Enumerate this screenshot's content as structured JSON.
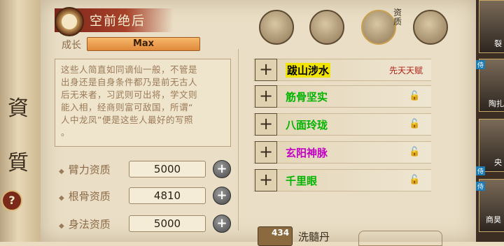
{
  "scroll": {
    "chars": [
      "資",
      "質"
    ],
    "help_glyph": "?"
  },
  "header": {
    "title": "空前绝后",
    "icon": "yinyang-icon"
  },
  "growth": {
    "label": "成长",
    "value": "Max"
  },
  "description": {
    "lines": [
      "这些人简直如同谪仙一般，不管是",
      "出身还是自身条件都乃是前无古人",
      "后无来者，习武则可出将，学文则",
      "能入相，经商则富可敌国，所谓“",
      "人中龙凤”便是这些人最好的写照",
      "。"
    ]
  },
  "attributes": [
    {
      "label": "臂力资质",
      "value": "5000"
    },
    {
      "label": "根骨资质",
      "value": "4810"
    },
    {
      "label": "身法资质",
      "value": "5000"
    }
  ],
  "tabs": [
    {
      "icon": "hat-icon"
    },
    {
      "icon": "map-icon"
    },
    {
      "icon": "bagua-icon",
      "badge": "资质"
    },
    {
      "icon": "body-icon"
    }
  ],
  "skills": [
    {
      "name": "跋山涉水",
      "color": "#1a1a1a",
      "highlight": "#f0e400",
      "note": "先天天赋"
    },
    {
      "name": "筋骨坚实",
      "color": "#00b400",
      "highlight": "",
      "note": ""
    },
    {
      "name": "八面玲珑",
      "color": "#00b400",
      "highlight": "",
      "note": ""
    },
    {
      "name": "玄阳神脉",
      "color": "#c400c4",
      "highlight": "",
      "note": ""
    },
    {
      "name": "千里眼",
      "color": "#00b400",
      "highlight": "",
      "note": ""
    }
  ],
  "item": {
    "count": "434",
    "name": "洗髓丹"
  },
  "portraits": [
    {
      "name": "裂",
      "tag": ""
    },
    {
      "name": "陶扎",
      "tag": "侍"
    },
    {
      "name": "央",
      "tag": "侍"
    },
    {
      "name": "商昊",
      "tag": "侍"
    }
  ]
}
